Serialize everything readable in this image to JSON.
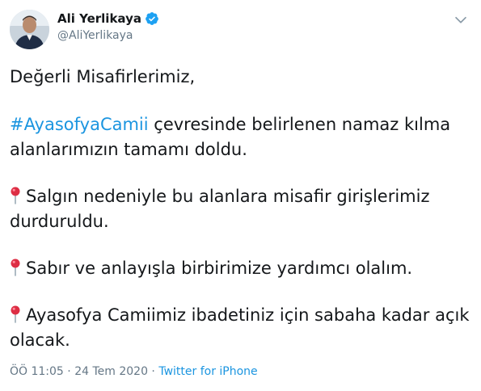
{
  "author": {
    "display_name": "Ali Yerlikaya",
    "handle": "@AliYerlikaya",
    "verified": true,
    "avatar_icon": "user-avatar-photo"
  },
  "menu_icon": "chevron-down-icon",
  "tweet": {
    "line1": "Değerli Misafirlerimiz,",
    "hashtag": "#AyasofyaCamii",
    "hashtag_text": " çevresinde belirlenen namaz kılma alanlarımızın tamamı doldu.",
    "pin_icon": "round-pushpin-icon",
    "point1": "Salgın nedeniyle bu alanlara misafir girişlerimiz durduruldu.",
    "point2": "Sabır ve anlayışla birbirimize yardımcı olalım.",
    "point3": "Ayasofya Camiimiz ibadetiniz için sabaha kadar açık olacak."
  },
  "meta": {
    "time": "ÖÖ 11:05",
    "separator": " · ",
    "date": "24 Tem 2020",
    "separator2": " · ",
    "source": "Twitter for iPhone"
  },
  "colors": {
    "link": "#1b95e0",
    "verified": "#1da1f2",
    "secondary_text": "#657786",
    "pin": "#dd2e44"
  }
}
